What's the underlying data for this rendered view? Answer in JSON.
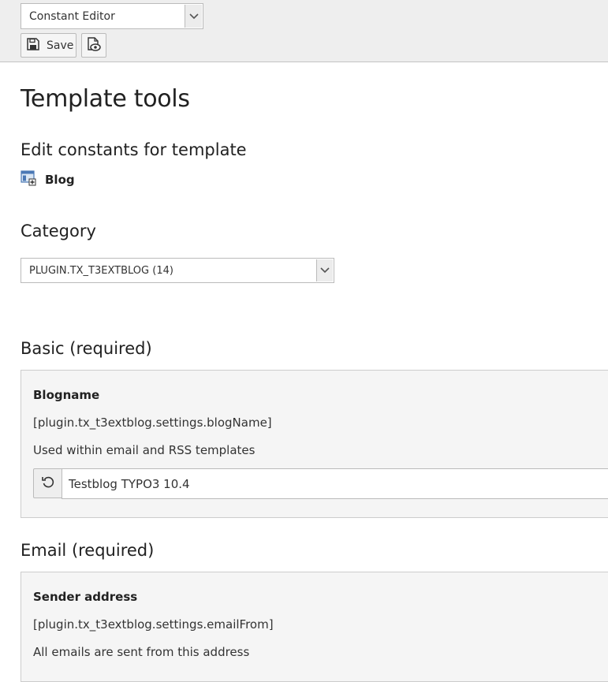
{
  "docheader": {
    "module_select": {
      "selected": "Constant Editor"
    },
    "save_button": {
      "label": "Save"
    }
  },
  "page": {
    "title": "Template tools",
    "edit_heading": "Edit constants for template",
    "template_name": "Blog",
    "category_heading": "Category",
    "category_select": {
      "selected": "PLUGIN.TX_T3EXTBLOG (14)"
    }
  },
  "sections": [
    {
      "heading": "Basic (required)",
      "field": {
        "title": "Blogname",
        "key": "[plugin.tx_t3extblog.settings.blogName]",
        "description": "Used within email and RSS templates",
        "value": "Testblog TYPO3 10.4"
      }
    },
    {
      "heading": "Email (required)",
      "field": {
        "title": "Sender address",
        "key": "[plugin.tx_t3extblog.settings.emailFrom]",
        "description": "All emails are sent from this address"
      }
    }
  ]
}
